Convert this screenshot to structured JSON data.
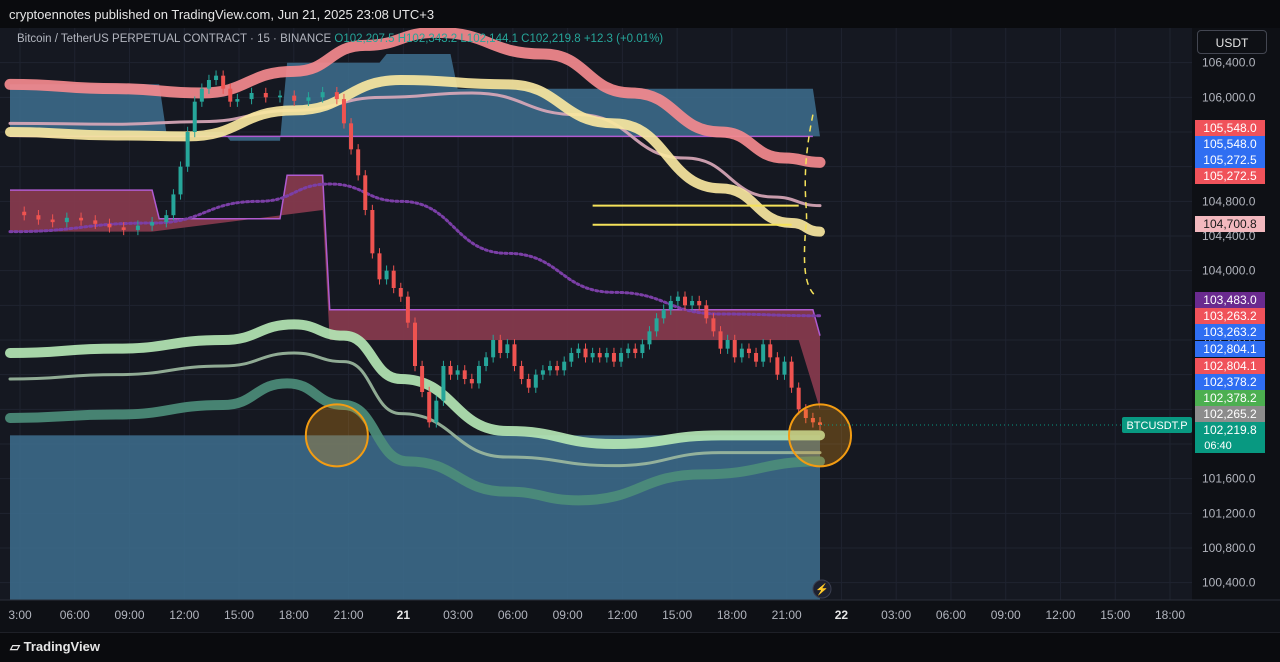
{
  "header": {
    "publisher_line": "cryptoennotes published on TradingView.com, Jun 21, 2025 23:08 UTC+3"
  },
  "symbol": {
    "name": "Bitcoin / TetherUS PERPETUAL CONTRACT · 15 · BINANCE",
    "open": "O102,207.5",
    "high": "H102,343.2",
    "low": "L102,144.1",
    "close": "C102,219.8",
    "change": "+12.3 (+0.01%)"
  },
  "currency": "USDT",
  "ticker_tag": "BTCUSDT.P",
  "countdown": "06:40",
  "footer": {
    "brand": "TradingView"
  },
  "colors": {
    "background": "#151821",
    "cloud_blue": "#3d6f8e",
    "cloud_red": "#8a3b4f",
    "band_red": "#f48a8e",
    "band_yellow": "#f9e7a0",
    "band_green_light": "#b4e6b4",
    "band_green_dark": "#4c8d7a",
    "purple_dots": "#7b3fa6",
    "price_up": "#26a69a",
    "price_down": "#ef5350"
  },
  "chart_data": {
    "type": "line",
    "title": "Bitcoin / TetherUS PERPETUAL CONTRACT · 15 · BINANCE",
    "x_tick_labels": [
      "3:00",
      "06:00",
      "09:00",
      "12:00",
      "15:00",
      "18:00",
      "21:00",
      "21",
      "03:00",
      "06:00",
      "09:00",
      "12:00",
      "15:00",
      "18:00",
      "21:00",
      "22",
      "03:00",
      "06:00",
      "09:00",
      "12:00",
      "15:00",
      "18:00"
    ],
    "y_tick_labels": [
      "106,400.0",
      "106,000.0",
      "105,600.0",
      "105,200.0",
      "104,800.0",
      "104,400.0",
      "104,000.0",
      "103,600.0",
      "103,200.0",
      "102,800.0",
      "102,400.0",
      "102,000.0",
      "101,600.0",
      "101,200.0",
      "100,800.0",
      "100,400.0"
    ],
    "ylim": [
      100200,
      106800
    ],
    "price_labels": [
      {
        "value": "105,548.0",
        "price": 105548.0,
        "color": "#f0525a"
      },
      {
        "value": "105,548.0",
        "price": 105548.0,
        "color": "#2f6ef2"
      },
      {
        "value": "105,272.5",
        "price": 105272.5,
        "color": "#2f6ef2"
      },
      {
        "value": "105,272.5",
        "price": 105272.5,
        "color": "#f0525a"
      },
      {
        "value": "104,700.8",
        "price": 104700.8,
        "color": "#f2b8be"
      },
      {
        "value": "103,483.0",
        "price": 103483.0,
        "color": "#6a2a8f"
      },
      {
        "value": "103,263.2",
        "price": 103263.2,
        "color": "#f0525a"
      },
      {
        "value": "103,263.2",
        "price": 103263.2,
        "color": "#2f6ef2"
      },
      {
        "value": "102,804.1",
        "price": 102804.1,
        "color": "#2f6ef2"
      },
      {
        "value": "102,804.1",
        "price": 102804.1,
        "color": "#f0525a"
      },
      {
        "value": "102,378.2",
        "price": 102378.2,
        "color": "#2f6ef2"
      },
      {
        "value": "102,378.2",
        "price": 102378.2,
        "color": "#4caf50"
      },
      {
        "value": "102,265.2",
        "price": 102265.2,
        "color": "#8c8c8c"
      },
      {
        "value": "102,219.8",
        "price": 102219.8,
        "color": "#089981"
      }
    ],
    "price_series": [
      [
        0,
        104680
      ],
      [
        4,
        104640
      ],
      [
        8,
        104590
      ],
      [
        12,
        104560
      ],
      [
        16,
        104610
      ],
      [
        20,
        104580
      ],
      [
        24,
        104540
      ],
      [
        28,
        104500
      ],
      [
        32,
        104470
      ],
      [
        36,
        104520
      ],
      [
        40,
        104560
      ],
      [
        44,
        104640
      ],
      [
        46,
        104880
      ],
      [
        48,
        105200
      ],
      [
        50,
        105600
      ],
      [
        52,
        105950
      ],
      [
        54,
        106100
      ],
      [
        56,
        106200
      ],
      [
        58,
        106250
      ],
      [
        60,
        106100
      ],
      [
        62,
        105950
      ],
      [
        64,
        105980
      ],
      [
        68,
        106050
      ],
      [
        72,
        106000
      ],
      [
        76,
        106020
      ],
      [
        80,
        105960
      ],
      [
        84,
        106000
      ],
      [
        88,
        106060
      ],
      [
        92,
        105980
      ],
      [
        94,
        105700
      ],
      [
        96,
        105400
      ],
      [
        98,
        105100
      ],
      [
        100,
        104700
      ],
      [
        102,
        104200
      ],
      [
        104,
        103900
      ],
      [
        106,
        104000
      ],
      [
        108,
        103800
      ],
      [
        110,
        103700
      ],
      [
        112,
        103400
      ],
      [
        114,
        102900
      ],
      [
        116,
        102600
      ],
      [
        118,
        102250
      ],
      [
        120,
        102500
      ],
      [
        122,
        102900
      ],
      [
        124,
        102800
      ],
      [
        126,
        102850
      ],
      [
        128,
        102750
      ],
      [
        130,
        102700
      ],
      [
        132,
        102900
      ],
      [
        134,
        103000
      ],
      [
        136,
        103200
      ],
      [
        138,
        103050
      ],
      [
        140,
        103150
      ],
      [
        142,
        102900
      ],
      [
        144,
        102750
      ],
      [
        146,
        102650
      ],
      [
        148,
        102800
      ],
      [
        150,
        102850
      ],
      [
        152,
        102900
      ],
      [
        154,
        102850
      ],
      [
        156,
        102950
      ],
      [
        158,
        103050
      ],
      [
        160,
        103100
      ],
      [
        162,
        103000
      ],
      [
        164,
        103050
      ],
      [
        166,
        103000
      ],
      [
        168,
        103050
      ],
      [
        170,
        102950
      ],
      [
        172,
        103050
      ],
      [
        174,
        103100
      ],
      [
        176,
        103050
      ],
      [
        178,
        103150
      ],
      [
        180,
        103300
      ],
      [
        182,
        103450
      ],
      [
        184,
        103550
      ],
      [
        186,
        103650
      ],
      [
        188,
        103700
      ],
      [
        190,
        103600
      ],
      [
        192,
        103650
      ],
      [
        194,
        103600
      ],
      [
        196,
        103450
      ],
      [
        198,
        103300
      ],
      [
        200,
        103100
      ],
      [
        202,
        103200
      ],
      [
        204,
        103000
      ],
      [
        206,
        103100
      ],
      [
        208,
        103050
      ],
      [
        210,
        102950
      ],
      [
        212,
        103150
      ],
      [
        214,
        103000
      ],
      [
        216,
        102800
      ],
      [
        218,
        102950
      ],
      [
        220,
        102650
      ],
      [
        222,
        102400
      ],
      [
        224,
        102300
      ],
      [
        226,
        102250
      ],
      [
        228,
        102219.8
      ]
    ],
    "series": [
      {
        "name": "",
        "color": "#f48a8e",
        "points": [
          [
            0,
            106150
          ],
          [
            30,
            106100
          ],
          [
            54,
            106050
          ],
          [
            80,
            106300
          ],
          [
            100,
            106600
          ],
          [
            120,
            106750
          ],
          [
            150,
            106500
          ],
          [
            175,
            106050
          ],
          [
            200,
            105600
          ],
          [
            218,
            105300
          ],
          [
            228,
            105250
          ]
        ]
      },
      {
        "name": "",
        "color": "#d9a8b8",
        "points": [
          [
            0,
            105700
          ],
          [
            30,
            105690
          ],
          [
            54,
            105720
          ],
          [
            80,
            105850
          ],
          [
            105,
            106000
          ],
          [
            130,
            106050
          ],
          [
            160,
            105800
          ],
          [
            190,
            105300
          ],
          [
            215,
            104850
          ],
          [
            228,
            104750
          ]
        ]
      },
      {
        "name": "",
        "color": "#f9e7a0",
        "points": [
          [
            0,
            105600
          ],
          [
            30,
            105560
          ],
          [
            50,
            105550
          ],
          [
            80,
            105850
          ],
          [
            110,
            106200
          ],
          [
            140,
            106150
          ],
          [
            170,
            105700
          ],
          [
            200,
            104950
          ],
          [
            220,
            104550
          ],
          [
            228,
            104450
          ]
        ]
      },
      {
        "name": "",
        "color": "#b4e6b4",
        "points": [
          [
            0,
            103050
          ],
          [
            30,
            103100
          ],
          [
            60,
            103200
          ],
          [
            80,
            103380
          ],
          [
            94,
            103250
          ],
          [
            110,
            102750
          ],
          [
            140,
            102150
          ],
          [
            170,
            102000
          ],
          [
            200,
            102100
          ],
          [
            228,
            102100
          ]
        ]
      },
      {
        "name": "",
        "color": "#9bb89e",
        "points": [
          [
            0,
            102750
          ],
          [
            30,
            102800
          ],
          [
            60,
            102900
          ],
          [
            80,
            103050
          ],
          [
            94,
            102950
          ],
          [
            110,
            102350
          ],
          [
            140,
            101850
          ],
          [
            170,
            101750
          ],
          [
            200,
            101900
          ],
          [
            228,
            101900
          ]
        ]
      },
      {
        "name": "",
        "color": "#4c8d7a",
        "points": [
          [
            0,
            102300
          ],
          [
            30,
            102340
          ],
          [
            60,
            102450
          ],
          [
            78,
            102700
          ],
          [
            94,
            102450
          ],
          [
            112,
            101800
          ],
          [
            140,
            101450
          ],
          [
            160,
            101350
          ],
          [
            195,
            101650
          ],
          [
            228,
            101800
          ]
        ]
      },
      {
        "name": "",
        "color": "#7b3fa6",
        "points": [
          [
            0,
            104450
          ],
          [
            40,
            104550
          ],
          [
            70,
            104800
          ],
          [
            90,
            105000
          ],
          [
            110,
            104800
          ],
          [
            140,
            104200
          ],
          [
            170,
            103750
          ],
          [
            200,
            103500
          ],
          [
            228,
            103480
          ]
        ]
      }
    ],
    "cloud_blue_upper": [
      [
        0,
        106150
      ],
      [
        42,
        106150
      ],
      [
        44,
        105600
      ],
      [
        60,
        105600
      ],
      [
        62,
        105500
      ],
      [
        76,
        105500
      ],
      [
        78,
        106400
      ],
      [
        104,
        106400
      ],
      [
        106,
        106500
      ],
      [
        124,
        106500
      ],
      [
        126,
        106100
      ],
      [
        226,
        106100
      ]
    ],
    "cloud_red_upper": [
      [
        0,
        104930
      ],
      [
        40,
        104930
      ],
      [
        42,
        104600
      ],
      [
        76,
        104600
      ],
      [
        78,
        105100
      ],
      [
        88,
        105100
      ],
      [
        90,
        103550
      ],
      [
        226,
        103550
      ],
      [
        228,
        103250
      ]
    ],
    "cloud_blue_lower": [
      [
        0,
        102100
      ],
      [
        228,
        102100
      ]
    ],
    "yellow_hlines": [
      {
        "price": 104750,
        "x1": 164,
        "x2": 222
      },
      {
        "price": 104530,
        "x1": 164,
        "x2": 220
      }
    ],
    "circles": [
      {
        "x": 92,
        "price": 102100
      },
      {
        "x": 228,
        "price": 102100
      }
    ]
  }
}
